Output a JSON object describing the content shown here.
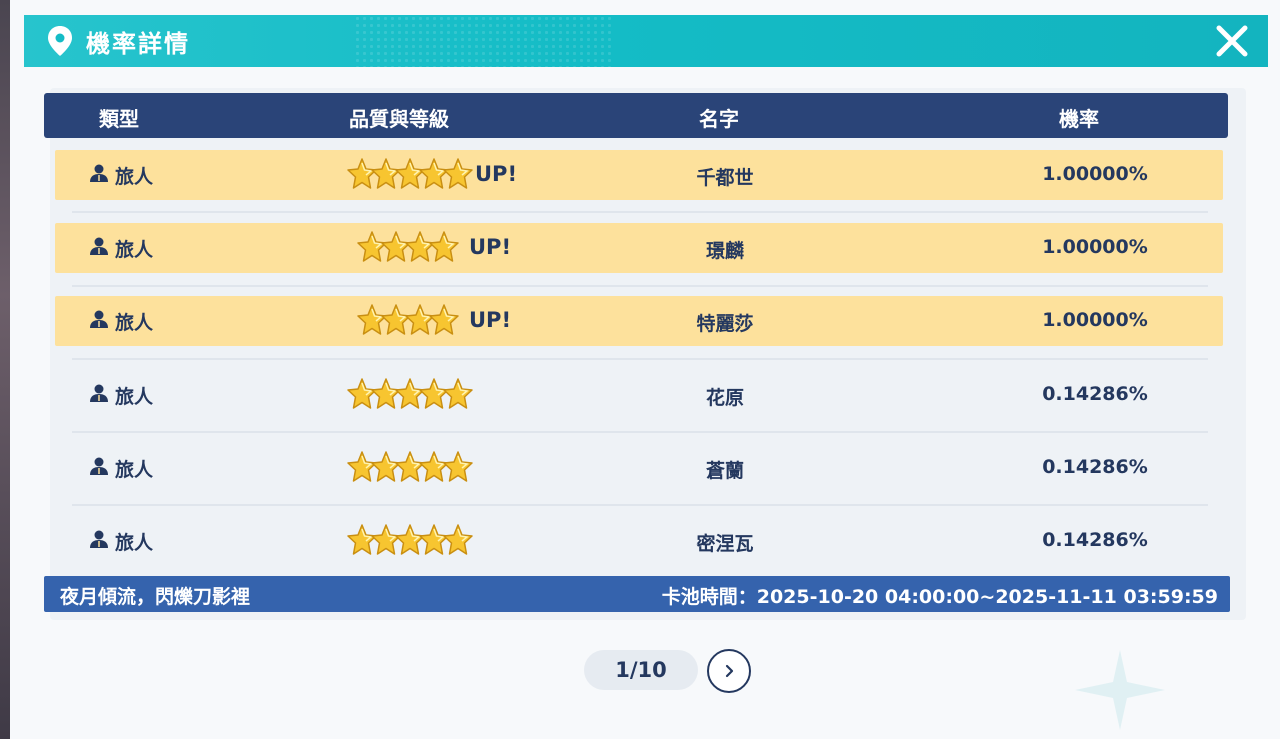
{
  "header": {
    "title": "機率詳情",
    "icon": "map-pin-icon",
    "close": "close-icon"
  },
  "colors": {
    "header": "#14bcc6",
    "table_head": "#2a4478",
    "up_row": "#fde19c",
    "footer": "#3563ad",
    "star": "#f7c530"
  },
  "table": {
    "columns": {
      "type": "類型",
      "quality": "品質與等級",
      "name": "名字",
      "rate": "機率"
    },
    "rows": [
      {
        "type": "旅人",
        "stars": 5,
        "up": "UP!",
        "name": "千都世",
        "rate": "1.00000%"
      },
      {
        "type": "旅人",
        "stars": 4,
        "up": "UP!",
        "name": "璟麟",
        "rate": "1.00000%"
      },
      {
        "type": "旅人",
        "stars": 4,
        "up": "UP!",
        "name": "特麗莎",
        "rate": "1.00000%"
      },
      {
        "type": "旅人",
        "stars": 5,
        "up": "",
        "name": "花原",
        "rate": "0.14286%"
      },
      {
        "type": "旅人",
        "stars": 5,
        "up": "",
        "name": "蒼蘭",
        "rate": "0.14286%"
      },
      {
        "type": "旅人",
        "stars": 5,
        "up": "",
        "name": "密涅瓦",
        "rate": "0.14286%"
      }
    ]
  },
  "footer": {
    "pool_name": "夜月傾流，閃爍刀影裡",
    "pool_time": "卡池時間：2025-10-20 04:00:00~2025-11-11 03:59:59"
  },
  "pager": {
    "label": "1/10"
  }
}
